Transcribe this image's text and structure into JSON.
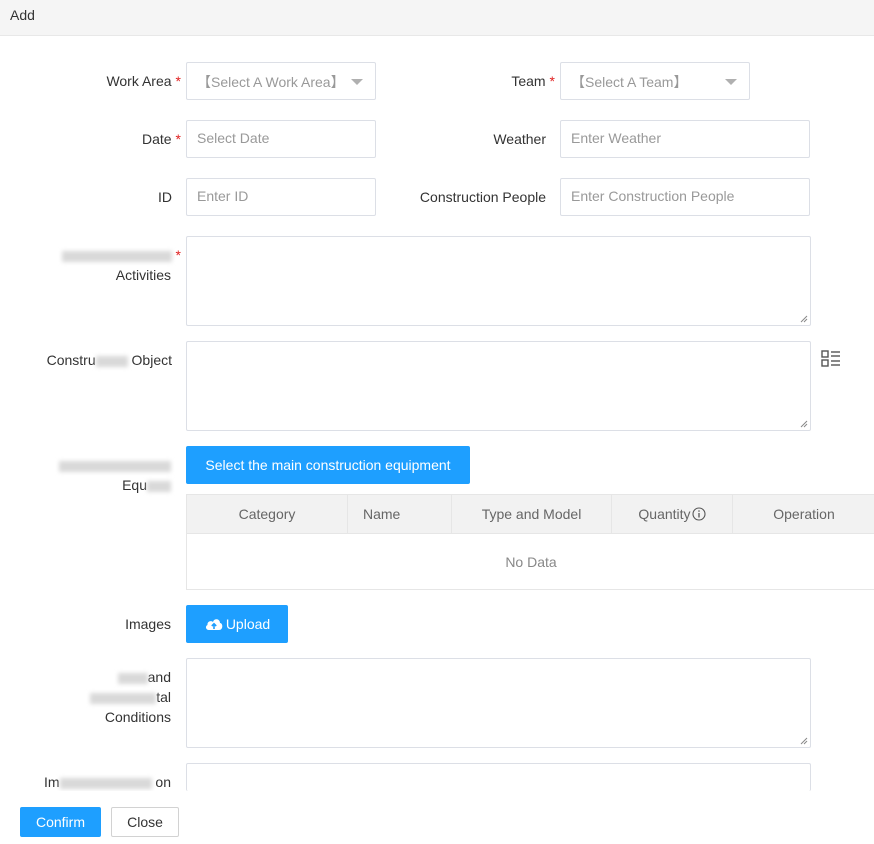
{
  "window": {
    "title": "Add"
  },
  "form": {
    "work_area": {
      "label": "Work Area",
      "required": "*",
      "value": "【Select A Work Area】"
    },
    "team": {
      "label": "Team",
      "required": "*",
      "value": "【Select A Team】"
    },
    "date": {
      "label": "Date",
      "required": "*",
      "placeholder": "Select Date"
    },
    "weather": {
      "label": "Weather",
      "placeholder": "Enter Weather"
    },
    "id": {
      "label": "ID",
      "placeholder": "Enter ID"
    },
    "construction_people": {
      "label": "Construction People",
      "placeholder": "Enter Construction People"
    },
    "main_activities": {
      "label_line2": "Activities",
      "required": "*"
    },
    "construction_object": {
      "label_start": "Constru",
      "label_end": "Object"
    },
    "equipment": {
      "label_line2_start": "Equ",
      "button_label": "Select the main construction equipment"
    },
    "images": {
      "label": "Images",
      "upload_label": "Upload"
    },
    "conditions": {
      "label_line1_end": "and",
      "label_line2_end": "tal",
      "label_line3": "Conditions"
    },
    "immediate": {
      "label_start": "Im",
      "label_end": "on"
    }
  },
  "equipment_table": {
    "columns": [
      "Category",
      "Name",
      "Type and Model",
      "Quantity",
      "Operation"
    ],
    "empty_text": "No Data"
  },
  "footer": {
    "confirm_label": "Confirm",
    "close_label": "Close"
  },
  "colors": {
    "primary": "#1e9fff",
    "required": "#e02020",
    "border": "#dcdfe6"
  },
  "icons": [
    "list-picker-icon",
    "info-circle-icon",
    "cloud-upload-icon",
    "chevron-down-icon",
    "resize-grip-icon"
  ]
}
